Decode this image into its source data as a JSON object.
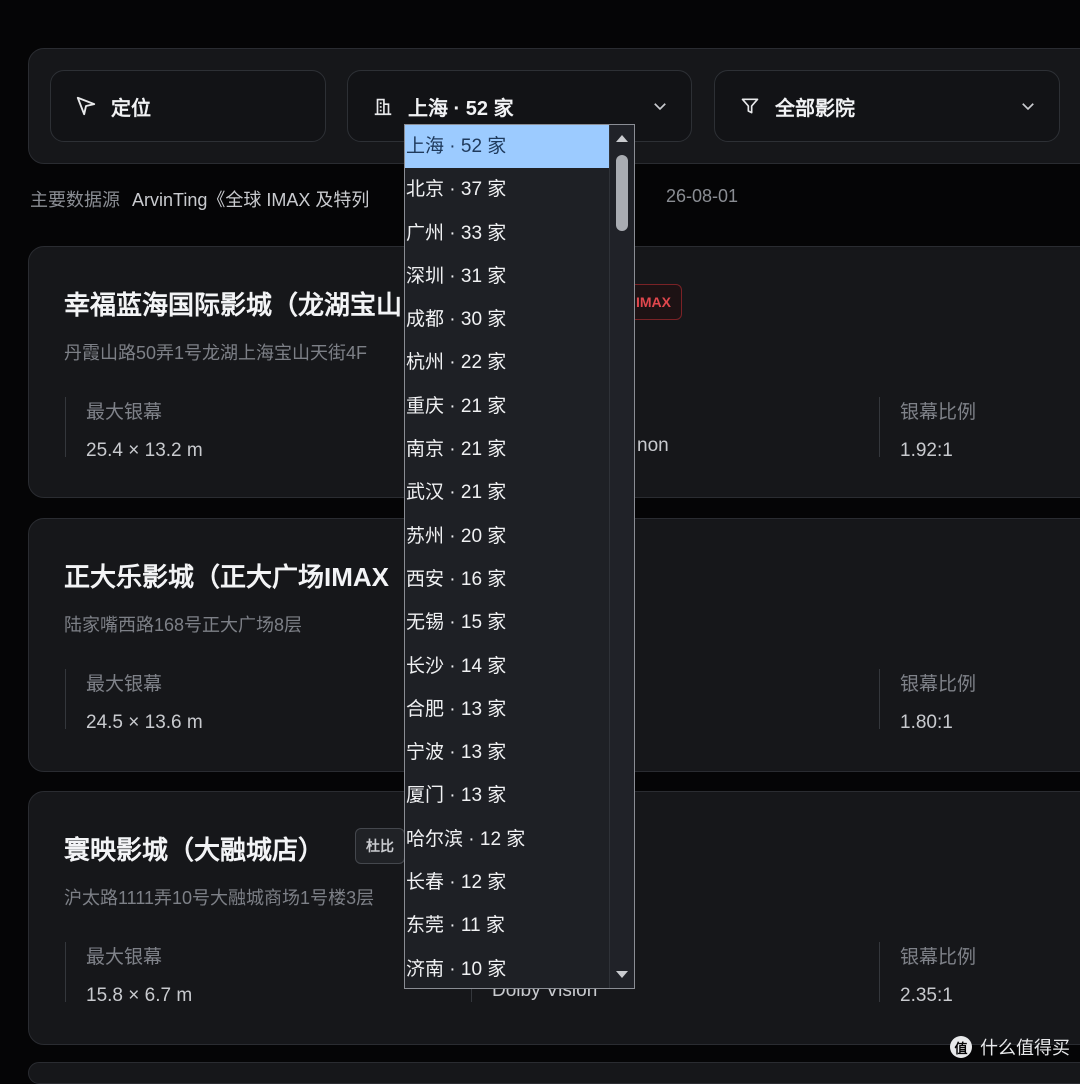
{
  "controls": {
    "locate_label": "定位",
    "city_label": "上海 · 52 家",
    "filter_label": "全部影院"
  },
  "source": {
    "prefix": "主要数据源",
    "author": "ArvinTing《全球 IMAX 及特列",
    "date": "26-08-01"
  },
  "cinemas": [
    {
      "title": "幸福蓝海国际影城（龙湖宝山",
      "badge": "IMAX",
      "address": "丹霞山路50弄1号龙湖上海宝山天街4F",
      "stats": [
        {
          "label": "最大银幕",
          "value": "25.4 × 13.2 m"
        },
        {
          "label": "",
          "value": "non"
        },
        {
          "label": "银幕比例",
          "value": "1.92:1"
        }
      ]
    },
    {
      "title": "正大乐影城（正大广场IMAX",
      "address": "陆家嘴西路168号正大广场8层",
      "stats": [
        {
          "label": "最大银幕",
          "value": "24.5 × 13.6 m"
        },
        {
          "label": "银幕比例",
          "value": "1.80:1"
        }
      ]
    },
    {
      "title": "寰映影城（大融城店）",
      "badge": "杜比",
      "address": "沪太路1111弄10号大融城商场1号楼3层",
      "stats": [
        {
          "label": "最大银幕",
          "value": "15.8 × 6.7 m"
        },
        {
          "label": "",
          "value": "Dolby Vision"
        },
        {
          "label": "银幕比例",
          "value": "2.35:1"
        }
      ]
    }
  ],
  "city_options": [
    "上海 · 52 家",
    "北京 · 37 家",
    "广州 · 33 家",
    "深圳 · 31 家",
    "成都 · 30 家",
    "杭州 · 22 家",
    "重庆 · 21 家",
    "南京 · 21 家",
    "武汉 · 21 家",
    "苏州 · 20 家",
    "西安 · 16 家",
    "无锡 · 15 家",
    "长沙 · 14 家",
    "合肥 · 13 家",
    "宁波 · 13 家",
    "厦门 · 13 家",
    "哈尔滨 · 12 家",
    "长春 · 12 家",
    "东莞 · 11 家",
    "济南 · 10 家"
  ],
  "selected_city_index": 0,
  "watermark": {
    "logo": "值",
    "text": "什么值得买"
  }
}
